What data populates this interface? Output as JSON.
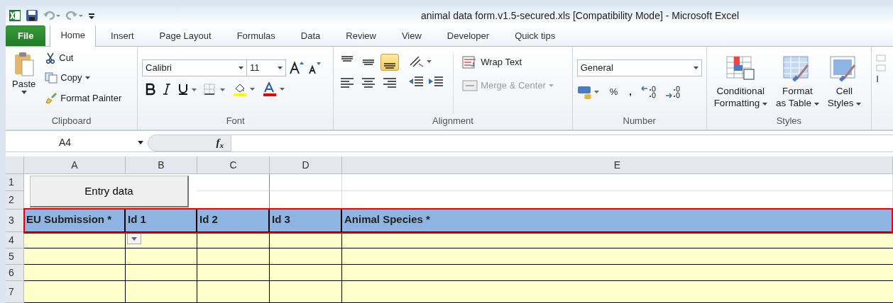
{
  "window": {
    "title": "animal data form.v1.5-secured.xls  [Compatibility Mode]  -  Microsoft Excel"
  },
  "tabs": [
    {
      "label": "File",
      "kind": "file",
      "selected": false
    },
    {
      "label": "Home",
      "kind": "tab",
      "selected": true
    },
    {
      "label": "Insert",
      "kind": "tab",
      "selected": false
    },
    {
      "label": "Page Layout",
      "kind": "tab",
      "selected": false
    },
    {
      "label": "Formulas",
      "kind": "tab",
      "selected": false
    },
    {
      "label": "Data",
      "kind": "tab",
      "selected": false
    },
    {
      "label": "Review",
      "kind": "tab",
      "selected": false
    },
    {
      "label": "View",
      "kind": "tab",
      "selected": false
    },
    {
      "label": "Developer",
      "kind": "tab",
      "selected": false
    },
    {
      "label": "Quick tips",
      "kind": "tab",
      "selected": false
    }
  ],
  "clipboard": {
    "title": "Clipboard",
    "paste": "Paste",
    "cut": "Cut",
    "copy": "Copy",
    "format_painter": "Format Painter"
  },
  "font": {
    "title": "Font",
    "font_name": "Calibri",
    "font_size": "11"
  },
  "alignment": {
    "title": "Alignment",
    "vertical": [
      {
        "kind": "top",
        "selected": false
      },
      {
        "kind": "middle",
        "selected": false
      },
      {
        "kind": "bottom",
        "selected": true
      }
    ],
    "wrap_text": "Wrap Text",
    "merge_center": {
      "label": "Merge & Center",
      "disabled": true
    }
  },
  "number": {
    "title": "Number",
    "format": "General",
    "percent": "%",
    "comma": ","
  },
  "styles": {
    "title": "Styles",
    "buttons": [
      {
        "kind": "conditional",
        "line1": "Conditional",
        "line2": "Formatting"
      },
      {
        "kind": "table",
        "line1": "Format",
        "line2": "as Table"
      },
      {
        "kind": "cell",
        "line1": "Cell",
        "line2": "Styles"
      }
    ]
  },
  "cut_group": {
    "label": "I"
  },
  "formula_bar": {
    "name_box": "A4",
    "fx": "f$_{x}$"
  },
  "sheet": {
    "columns": [
      "A",
      "B",
      "C",
      "D",
      "E"
    ],
    "rows": [
      "1",
      "2",
      "3",
      "4",
      "5",
      "6",
      "7"
    ],
    "button": "Entry data",
    "header_row": {
      "highlighted": true,
      "cells": [
        "EU Submission *",
        "Id 1",
        "Id 2",
        "Id 3",
        "Animal Species *"
      ]
    },
    "dropdown_cell": {
      "visible": true
    }
  }
}
